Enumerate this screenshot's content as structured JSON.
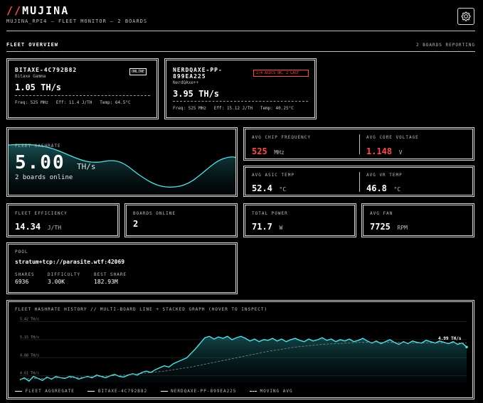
{
  "header": {
    "logo_slashes": "//",
    "logo_text": "MUJINA",
    "subtitle": "MUJINA_RPI4 — FLEET MONITOR — 2 BOARDS"
  },
  "fleet_overview": {
    "title": "FLEET OVERVIEW",
    "reporting": "2 BOARDS REPORTING"
  },
  "boards": [
    {
      "name": "BITAXE-4C792B82",
      "model": "Bitaxe Gamma",
      "status": "ONLINE",
      "hashrate": "1.05 TH/s",
      "freq": "Freq: 525 MHz",
      "eff": "Eff: 11.4 J/TH",
      "temp": "Temp: 64.5°C"
    },
    {
      "name_line1": "NERDQAXE-PP-",
      "name_line2": "899EA225",
      "model": "NerdQAxe++",
      "status": "2/4 ASICS OK, 2 LAST",
      "hashrate": "3.95 TH/s",
      "freq": "Freq: 525 MHz",
      "eff": "Eff: 15.12 J/TH",
      "temp": "Temp: 40.25°C"
    }
  ],
  "fleet_hashrate": {
    "label": "FLEET HASHRATE",
    "value": "5.00",
    "unit": "TH/s",
    "boards_online": "2 boards online"
  },
  "chip": {
    "freq_label": "AVG CHIP FREQUENCY",
    "freq_value": "525",
    "freq_unit": "MHz",
    "volt_label": "AVG CORE VOLTAGE",
    "volt_value": "1.148",
    "volt_unit": "V"
  },
  "temps": {
    "asic_label": "AVG ASIC TEMP",
    "asic_value": "52.4",
    "asic_unit": "°C",
    "vr_label": "AVG VR TEMP",
    "vr_value": "46.8",
    "vr_unit": "°C"
  },
  "metrics": {
    "efficiency_label": "FLEET EFFICIENCY",
    "efficiency_value": "14.34",
    "efficiency_unit": "J/TH",
    "online_label": "BOARDS ONLINE",
    "online_value": "2",
    "power_label": "TOTAL POWER",
    "power_value": "71.7",
    "power_unit": "W",
    "fan_label": "AVG FAN",
    "fan_value": "7725",
    "fan_unit": "RPM"
  },
  "pool": {
    "label": "POOL",
    "url": "stratum+tcp://parasite.wtf:42069",
    "shares_label": "SHARES",
    "shares_value": "6936",
    "difficulty_label": "DIFFICULTY",
    "difficulty_value": "3.00K",
    "best_label": "BEST SHARE",
    "best_value": "182.93M"
  },
  "history": {
    "title": "FLEET HASHRATE HISTORY // MULTI-BOARD LINE + STACKED GRAPH (HOVER TO INSPECT)",
    "current_label": "4.99 TH/s",
    "legend": {
      "aggregate": "FLEET AGGREGATE",
      "board1": "BITAXE-4C792B82",
      "board2": "NERDQAXE-PP-899EA225",
      "moving_avg": "MOVING AVG"
    }
  },
  "colors": {
    "accent_red": "#ff4a4a",
    "cyan": "#4fe3ea",
    "border": "#d8d8d8"
  },
  "chart_data": {
    "type": "line",
    "title": "FLEET HASHRATE HISTORY // MULTI-BOARD LINE + STACKED GRAPH (HOVER TO INSPECT)",
    "xlabel": "",
    "ylabel": "",
    "y_ticks": [
      "5.42 TH/s",
      "5.15 TH/s",
      "4.88 TH/s",
      "4.61 TH/s"
    ],
    "ylim": [
      4.5,
      5.5
    ],
    "grid": true,
    "legend": "bottom",
    "series": [
      {
        "name": "FLEET AGGREGATE",
        "values": [
          4.55,
          4.58,
          4.53,
          4.6,
          4.57,
          4.54,
          4.59,
          4.56,
          4.6,
          4.58,
          4.57,
          4.6,
          4.59,
          4.56,
          4.58,
          4.6,
          4.58,
          4.62,
          4.6,
          4.58,
          4.61,
          4.63,
          4.6,
          4.59,
          4.62,
          4.64,
          4.62,
          4.66,
          4.68,
          4.66,
          4.7,
          4.73,
          4.76,
          4.74,
          4.79,
          4.82,
          4.85,
          4.88,
          4.95,
          5.02,
          5.1,
          5.18,
          5.2,
          5.16,
          5.19,
          5.17,
          5.2,
          5.15,
          5.18,
          5.2,
          5.17,
          5.13,
          5.16,
          5.12,
          5.15,
          5.14,
          5.17,
          5.13,
          5.16,
          5.12,
          5.15,
          5.17,
          5.14,
          5.12,
          5.16,
          5.13,
          5.15,
          5.18,
          5.14,
          5.16,
          5.12,
          5.15,
          5.13,
          5.16,
          5.12,
          5.14,
          5.17,
          5.13,
          5.1,
          5.13,
          5.09,
          5.12,
          5.15,
          5.11,
          5.08,
          5.12,
          5.09,
          5.13,
          5.11,
          5.1,
          5.14,
          5.12,
          5.1,
          5.13,
          5.11,
          5.09,
          5.12,
          5.08,
          5.1,
          5.04
        ]
      },
      {
        "name": "MOVING AVG",
        "values": [
          4.56,
          4.57,
          4.57,
          4.58,
          4.58,
          4.59,
          4.6,
          4.61,
          4.62,
          4.64,
          4.66,
          4.68,
          4.71,
          4.74,
          4.78,
          4.82,
          4.86,
          4.9,
          4.94,
          4.98,
          5.01,
          5.04,
          5.06,
          5.08,
          5.09,
          5.1,
          5.11,
          5.11,
          5.11,
          5.11,
          5.1,
          5.1,
          5.1,
          5.1,
          5.1
        ]
      }
    ]
  }
}
